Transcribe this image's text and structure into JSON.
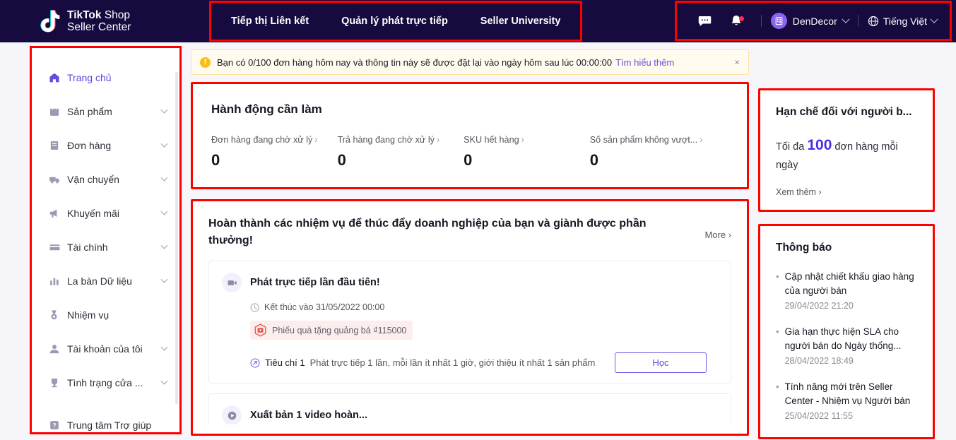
{
  "header": {
    "brand_line1_bold": "TikTok",
    "brand_line1_reg": "Shop",
    "brand_line2": "Seller Center",
    "nav": [
      {
        "label": "Tiếp thị Liên kết",
        "icon": "nav-link-icon"
      },
      {
        "label": "Quản lý phát trực tiếp",
        "icon": "nav-live-icon"
      },
      {
        "label": "Seller University",
        "icon": "nav-university-icon"
      }
    ],
    "chat_icon": "message-icon",
    "bell_icon": "bell-icon",
    "shop_name": "DenDecor",
    "shop_avatar_icon": "shop-building-icon",
    "language": "Tiếng Việt",
    "language_icon": "globe-icon",
    "chevron_icon": "chevron-down-icon"
  },
  "sidebar": {
    "items": [
      {
        "label": "Trang chủ",
        "icon": "home-icon",
        "active": true,
        "expandable": false
      },
      {
        "label": "Sản phẩm",
        "icon": "product-bag-icon",
        "active": false,
        "expandable": true
      },
      {
        "label": "Đơn hàng",
        "icon": "orders-doc-icon",
        "active": false,
        "expandable": true
      },
      {
        "label": "Vận chuyển",
        "icon": "shipping-truck-icon",
        "active": false,
        "expandable": true
      },
      {
        "label": "Khuyến mãi",
        "icon": "promotion-megaphone-icon",
        "active": false,
        "expandable": true
      },
      {
        "label": "Tài chính",
        "icon": "finance-card-icon",
        "active": false,
        "expandable": true
      },
      {
        "label": "La bàn Dữ liệu",
        "icon": "data-chart-icon",
        "active": false,
        "expandable": true
      },
      {
        "label": "Nhiệm vụ",
        "icon": "mission-medal-icon",
        "active": false,
        "expandable": false
      },
      {
        "label": "Tài khoản của tôi",
        "icon": "account-person-icon",
        "active": false,
        "expandable": true
      },
      {
        "label": "Tình trạng cửa ...",
        "icon": "store-health-trophy-icon",
        "active": false,
        "expandable": true
      },
      {
        "label": "Trung tâm Trợ giúp",
        "icon": "help-question-icon",
        "active": false,
        "expandable": false,
        "gap_before": true
      }
    ]
  },
  "banner": {
    "warn_icon": "warning-icon",
    "text": "Bạn có 0/100 đơn hàng hôm nay và thông tin này sẽ được đặt lại vào ngày hôm sau lúc 00:00:00",
    "link": "Tìm hiểu thêm",
    "close_icon": "close-icon",
    "close_label": "×"
  },
  "actions_card": {
    "title": "Hành động cần làm",
    "metrics": [
      {
        "label": "Đơn hàng đang chờ xử lý",
        "arrow": "›",
        "value": "0"
      },
      {
        "label": "Trả hàng đang chờ xử lý",
        "arrow": "›",
        "value": "0"
      },
      {
        "label": "SKU hết hàng",
        "arrow": "›",
        "value": "0"
      },
      {
        "label": "Số sản phẩm không vượt...",
        "arrow": "›",
        "value": "0"
      }
    ]
  },
  "tasks_card": {
    "title": "Hoàn thành các nhiệm vụ để thúc đẩy doanh nghiệp của bạn và giành được phần thưởng!",
    "more_label": "More ›",
    "task": {
      "avatar_icon": "video-camera-icon",
      "name": "Phát trực tiếp lần đầu tiên!",
      "clock_icon": "clock-icon",
      "deadline": "Kết thúc vào 31/05/2022 00:00",
      "voucher_icon": "voucher-gift-icon",
      "voucher_text": "Phiếu quà tặng quảng bá ₫115000",
      "criteria_icon": "target-arrow-icon",
      "criteria_label": "Tiêu chí 1",
      "criteria_desc": "Phát trực tiếp 1 lần, mỗi lần ít nhất 1 giờ, giới thiệu ít nhất 1 sản phẩm",
      "learn_button": "Học"
    },
    "task2": {
      "avatar_icon": "video-publish-icon",
      "name": "Xuất bản 1 video hoàn..."
    }
  },
  "limit_card": {
    "title": "Hạn chế đối với người b...",
    "prefix": "Tối đa",
    "number": "100",
    "suffix": "đơn hàng mỗi ngày",
    "see_more": "Xem thêm  ›"
  },
  "notifications_card": {
    "title": "Thông báo",
    "items": [
      {
        "title": "Cập nhật chiết khấu giao hàng của người bán",
        "time": "29/04/2022 21:20"
      },
      {
        "title": "Gia hạn thực hiện SLA cho người bán do Ngày thống...",
        "time": "28/04/2022 18:49"
      },
      {
        "title": "Tính năng mới trên Seller Center - Nhiệm vụ Người bán",
        "time": "25/04/2022 11:55"
      }
    ]
  },
  "colors": {
    "header_bg": "#160a3f",
    "accent_purple": "#5b4ae0",
    "highlight_red": "#ff0000",
    "banner_bg": "#fffbee",
    "page_bg": "#f6f6fa"
  }
}
